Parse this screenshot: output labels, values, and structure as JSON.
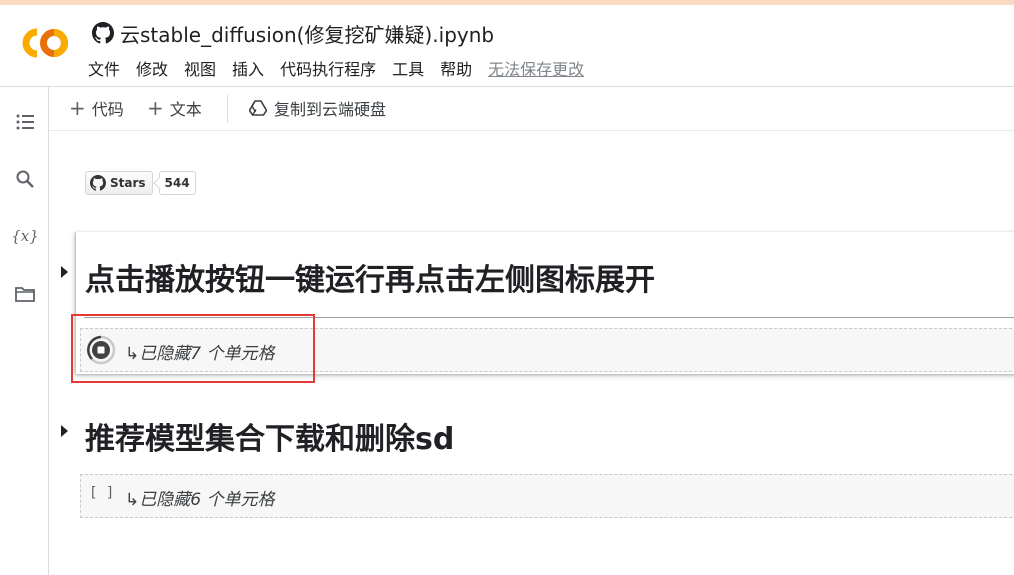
{
  "app": {
    "notebook_title": "云stable_diffusion(修复挖矿嫌疑).ipynb"
  },
  "menu": {
    "items": [
      "文件",
      "修改",
      "视图",
      "插入",
      "代码执行程序",
      "工具",
      "帮助"
    ],
    "unsaved_notice": "无法保存更改"
  },
  "toolbar": {
    "add_code_label": "代码",
    "add_text_label": "文本",
    "copy_to_drive_label": "复制到云端硬盘"
  },
  "rail": {
    "icons": [
      "toc-icon",
      "search-icon",
      "variables-icon",
      "folder-icon"
    ],
    "variables_glyph": "{x}"
  },
  "badge": {
    "label": "Stars",
    "count": "544"
  },
  "sections": [
    {
      "heading": "点击播放按钮一键运行再点击左侧图标展开",
      "hidden_cells_text": "已隐藏7 个单元格",
      "running": true
    },
    {
      "heading": "推荐模型集合下载和删除sd",
      "hidden_cells_text": "已隐藏6 个单元格",
      "brackets": "[ ]"
    }
  ],
  "colors": {
    "logo_orange": "#F9AB00",
    "logo_dark_orange": "#E8710A",
    "highlight_red": "#E53935",
    "muted_gray": "#80868B"
  }
}
